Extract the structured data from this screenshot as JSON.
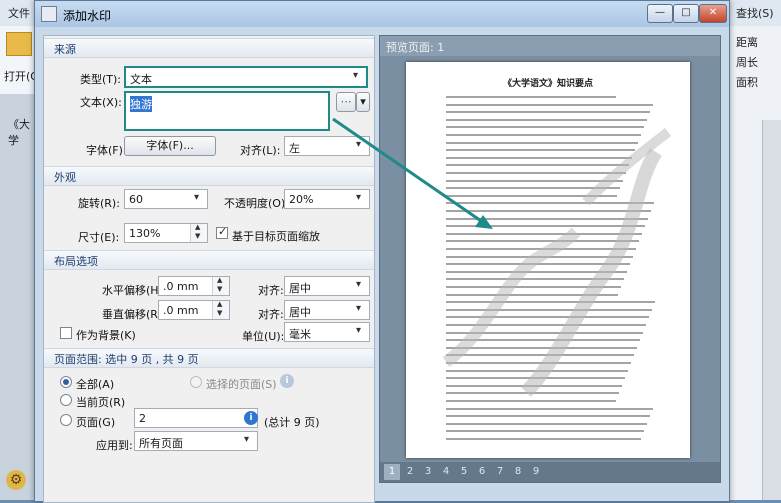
{
  "background_app": {
    "menu": [
      "文件",
      "查找(S)"
    ],
    "toolbar": {
      "open_label": "打开(O",
      "right_items": [
        "距离",
        "周长",
        "面积"
      ]
    },
    "doc_tab": "《大学"
  },
  "dialog": {
    "title": "添加水印",
    "window_buttons": [
      "—",
      "□",
      "✕"
    ],
    "source": {
      "heading": "来源",
      "type_label": "类型(T):",
      "type_value": "文本",
      "text_label": "文本(X):",
      "text_value": "独游",
      "font_label": "字体(F):",
      "font_button": "字体(F)...",
      "align_label": "对齐(L):",
      "align_value": "左"
    },
    "appearance": {
      "heading": "外观",
      "rotation_label": "旋转(R):",
      "rotation_value": "60",
      "opacity_label": "不透明度(O):",
      "opacity_value": "20%",
      "size_label": "尺寸(E):",
      "size_value": "130%",
      "scale_label": "基于目标页面缩放",
      "scale_checked": true
    },
    "layout": {
      "heading": "布局选项",
      "h_offset_label": "水平偏移(H):",
      "h_offset_value": ".0 mm",
      "h_align_label": "对齐:",
      "h_align_value": "居中",
      "v_offset_label": "垂直偏移(R):",
      "v_offset_value": ".0 mm",
      "v_align_label": "对齐:",
      "v_align_value": "居中",
      "background_label": "作为背景(K)",
      "background_checked": false,
      "unit_label": "单位(U):",
      "unit_value": "毫米"
    },
    "page_range": {
      "heading": "页面范围: 选中 9 页 , 共 9 页",
      "all_label": "全部(A)",
      "selected_label": "选择的页面(S)",
      "current_label": "当前页(R)",
      "pages_label": "页面(G)",
      "pages_value": "2",
      "total_label": "(总计 9 页)",
      "apply_label": "应用到:",
      "apply_value": "所有页面"
    },
    "preview": {
      "heading": "预览页面: 1",
      "doc_title": "《大学语文》知识要点",
      "pages": [
        "1",
        "2",
        "3",
        "4",
        "5",
        "6",
        "7",
        "8",
        "9"
      ],
      "current_page": "1"
    }
  },
  "colors": {
    "highlight": "#1f8a8a",
    "dialog_bg": "#c8d9ea"
  },
  "icons": [
    "app-icon",
    "text-options-icon",
    "info-icon",
    "settings-gear-icon"
  ]
}
